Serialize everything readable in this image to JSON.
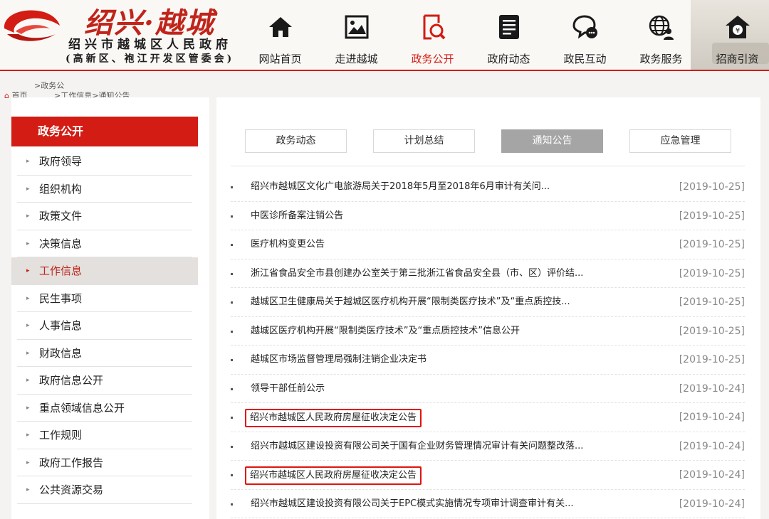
{
  "header": {
    "site_title": "绍兴·越城",
    "site_subtitle": "绍兴市越城区人民政府",
    "site_subtitle2": "(高新区、袍江开发区管委会)",
    "nav": [
      {
        "label": "网站首页",
        "icon": "home-icon"
      },
      {
        "label": "走进越城",
        "icon": "picture-icon"
      },
      {
        "label": "政务公开",
        "icon": "document-search-icon",
        "active": true
      },
      {
        "label": "政府动态",
        "icon": "newspaper-icon"
      },
      {
        "label": "政民互动",
        "icon": "chat-icon"
      },
      {
        "label": "政务服务",
        "icon": "globe-person-icon"
      },
      {
        "label": "招商引资",
        "icon": "money-house-icon"
      }
    ],
    "accent_color": "#d31c14"
  },
  "breadcrumb": {
    "line1": ">政务公",
    "line2_home": "首页",
    "line2_rest": ">工作信息>通知公告"
  },
  "sidebar": {
    "heading": "政务公开",
    "items": [
      {
        "label": "政府领导"
      },
      {
        "label": "组织机构"
      },
      {
        "label": "政策文件"
      },
      {
        "label": "决策信息"
      },
      {
        "label": "工作信息",
        "active": true
      },
      {
        "label": "民生事项"
      },
      {
        "label": "人事信息"
      },
      {
        "label": "财政信息"
      },
      {
        "label": "政府信息公开"
      },
      {
        "label": "重点领域信息公开"
      },
      {
        "label": "工作规则"
      },
      {
        "label": "政府工作报告"
      },
      {
        "label": "公共资源交易"
      }
    ]
  },
  "tabs": [
    {
      "label": "政务动态"
    },
    {
      "label": "计划总结"
    },
    {
      "label": "通知公告",
      "active": true
    },
    {
      "label": "应急管理"
    }
  ],
  "notices": [
    {
      "title": "绍兴市越城区文化广电旅游局关于2018年5月至2018年6月审计有关问...",
      "date": "[2019-10-25]"
    },
    {
      "title": "中医诊所备案注销公告",
      "date": "[2019-10-25]"
    },
    {
      "title": "医疗机构变更公告",
      "date": "[2019-10-25]"
    },
    {
      "title": "浙江省食品安全市县创建办公室关于第三批浙江省食品安全县（市、区）评价结...",
      "date": "[2019-10-25]"
    },
    {
      "title": "越城区卫生健康局关于越城区医疗机构开展“限制类医疗技术”及“重点质控技...",
      "date": "[2019-10-25]"
    },
    {
      "title": "越城区医疗机构开展“限制类医疗技术”及“重点质控技术”信息公开",
      "date": "[2019-10-25]"
    },
    {
      "title": "越城区市场监督管理局强制注销企业决定书",
      "date": "[2019-10-25]"
    },
    {
      "title": "领导干部任前公示",
      "date": "[2019-10-24]"
    },
    {
      "title": "绍兴市越城区人民政府房屋征收决定公告",
      "date": "[2019-10-24]",
      "highlighted": true
    },
    {
      "title": "绍兴市越城区建设投资有限公司关于国有企业财务管理情况审计有关问题整改落...",
      "date": "[2019-10-24]"
    },
    {
      "title": "绍兴市越城区人民政府房屋征收决定公告",
      "date": "[2019-10-24]",
      "highlighted": true
    },
    {
      "title": "绍兴市越城区建设投资有限公司关于EPC模式实施情况专项审计调查审计有关...",
      "date": "[2019-10-24]"
    }
  ]
}
